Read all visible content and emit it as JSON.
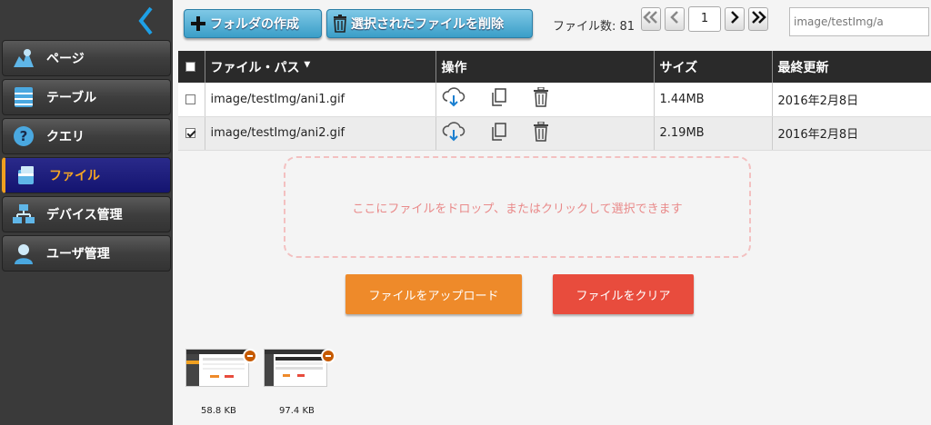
{
  "sidebar": {
    "items": [
      {
        "label": "ページ",
        "icon": "pages-icon"
      },
      {
        "label": "テーブル",
        "icon": "table-icon"
      },
      {
        "label": "クエリ",
        "icon": "query-icon"
      },
      {
        "label": "ファイル",
        "icon": "file-icon",
        "active": true
      },
      {
        "label": "デバイス管理",
        "icon": "device-icon"
      },
      {
        "label": "ユーザ管理",
        "icon": "user-icon"
      }
    ]
  },
  "toolbar": {
    "create_folder": "フォルダの作成",
    "delete_selected": "選択されたファイルを削除"
  },
  "pager": {
    "count_label": "ファイル数:",
    "count": "81",
    "page": "1"
  },
  "search": {
    "value": "image/testImg/a"
  },
  "table": {
    "headers": {
      "path": "ファイル・パス",
      "ops": "操作",
      "size": "サイズ",
      "updated": "最終更新"
    },
    "sort_indicator": "▼",
    "rows": [
      {
        "path": "image/testImg/ani1.gif",
        "size": "1.44MB",
        "updated": "2016年2月8日",
        "checked": false
      },
      {
        "path": "image/testImg/ani2.gif",
        "size": "2.19MB",
        "updated": "2016年2月8日",
        "checked": true
      }
    ]
  },
  "dropzone": {
    "text": "ここにファイルをドロップ、またはクリックして選択できます"
  },
  "actions": {
    "upload": "ファイルをアップロード",
    "clear": "ファイルをクリア",
    "upload_color": "#ee8a2a",
    "clear_color": "#e84c3d"
  },
  "thumbnails": [
    {
      "size": "58.8 KB"
    },
    {
      "size": "97.4 KB"
    }
  ]
}
